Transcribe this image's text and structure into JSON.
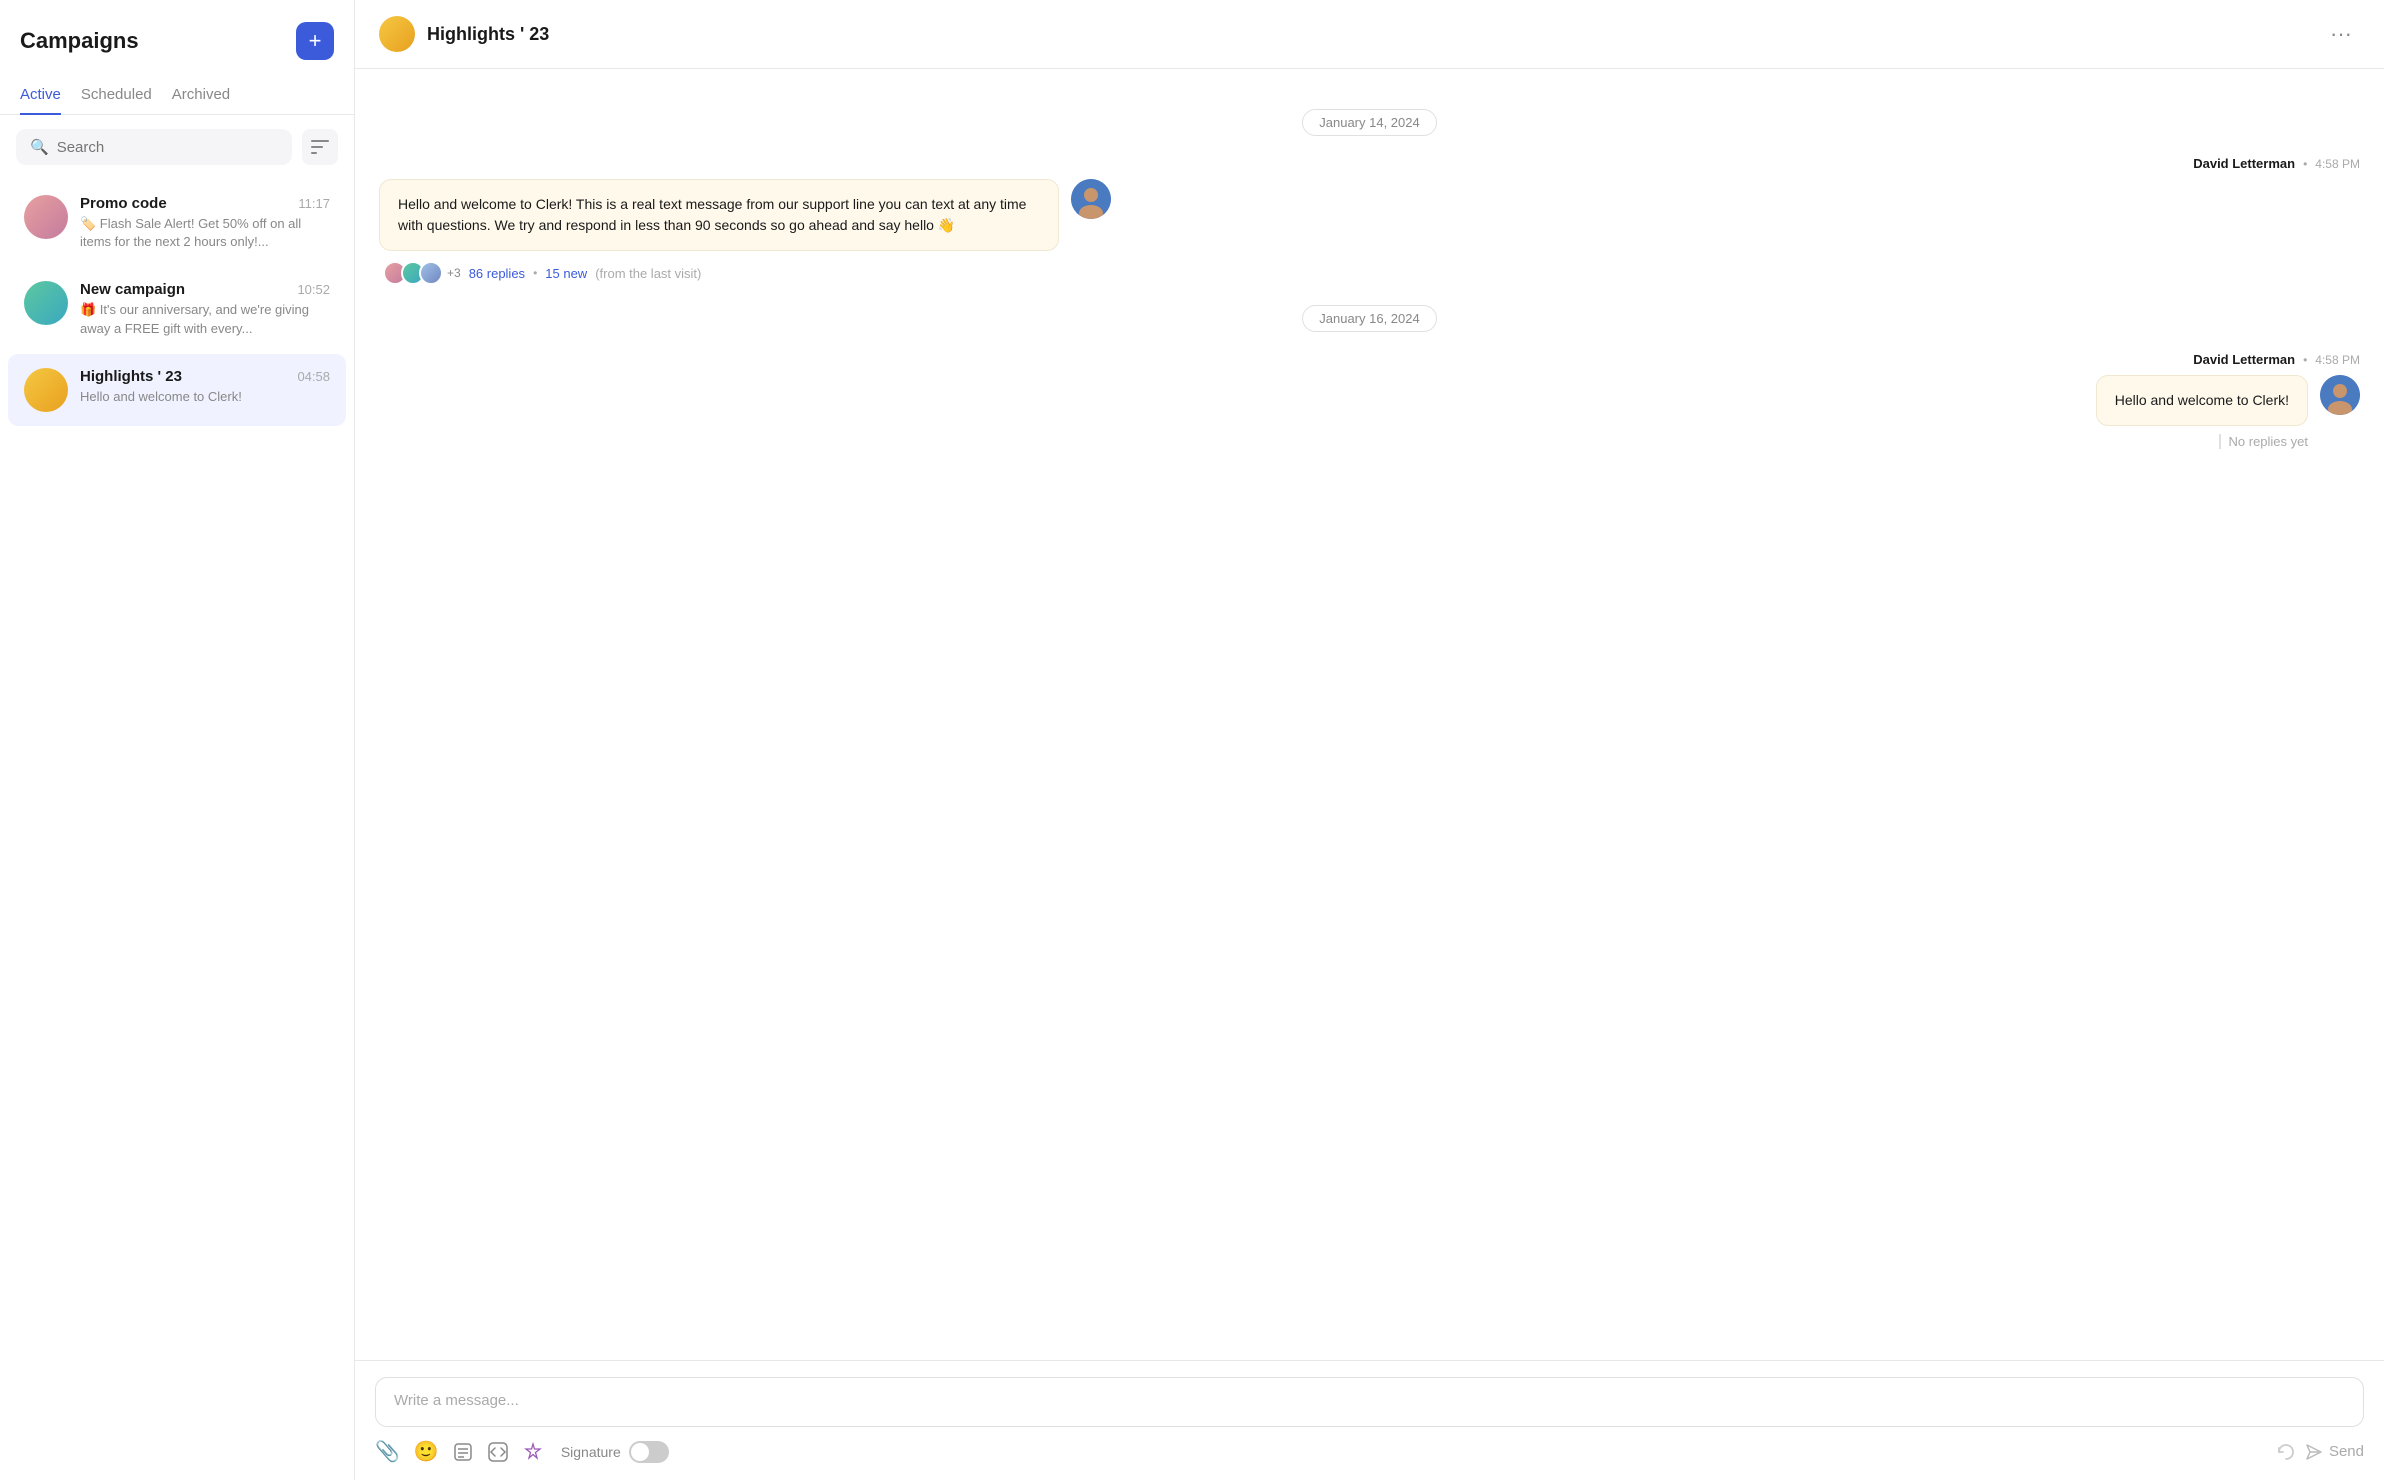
{
  "sidebar": {
    "title": "Campaigns",
    "add_button_label": "+",
    "tabs": [
      {
        "id": "active",
        "label": "Active",
        "active": true
      },
      {
        "id": "scheduled",
        "label": "Scheduled",
        "active": false
      },
      {
        "id": "archived",
        "label": "Archived",
        "active": false
      }
    ],
    "search": {
      "placeholder": "Search"
    },
    "campaigns": [
      {
        "id": "promo",
        "name": "Promo code",
        "time": "11:17",
        "preview": "🏷️ Flash Sale Alert! Get 50% off on all items for the next 2 hours only!...",
        "avatar_class": "avatar-promo"
      },
      {
        "id": "new-campaign",
        "name": "New campaign",
        "time": "10:52",
        "preview": "🎁 It's our anniversary, and we're giving away a FREE gift with every...",
        "avatar_class": "avatar-new"
      },
      {
        "id": "highlights",
        "name": "Highlights ' 23",
        "time": "04:58",
        "preview": "Hello and welcome to Clerk!",
        "avatar_class": "avatar-highlights",
        "selected": true
      }
    ]
  },
  "main": {
    "header": {
      "title": "Highlights ' 23",
      "avatar_class": "avatar-highlights",
      "more_icon": "···"
    },
    "messages": [
      {
        "date": "January 14, 2024",
        "items": [
          {
            "sender": "David Letterman",
            "time": "4:58 PM",
            "text": "Hello and welcome to Clerk! This is a real text message from our support line you can text at any time with questions. We try and respond in less than 90 seconds so go ahead and say hello 👋",
            "align": "left",
            "replies_count": "86 replies",
            "replies_new": "15 new",
            "replies_since": "(from the last visit)",
            "has_replies": true
          }
        ]
      },
      {
        "date": "January 16, 2024",
        "items": [
          {
            "sender": "David Letterman",
            "time": "4:58 PM",
            "text": "Hello and welcome to Clerk!",
            "align": "right",
            "has_replies": false,
            "no_replies_text": "No replies yet"
          }
        ]
      }
    ],
    "composer": {
      "placeholder": "Write a message...",
      "signature_label": "Signature",
      "send_label": "Send"
    }
  }
}
